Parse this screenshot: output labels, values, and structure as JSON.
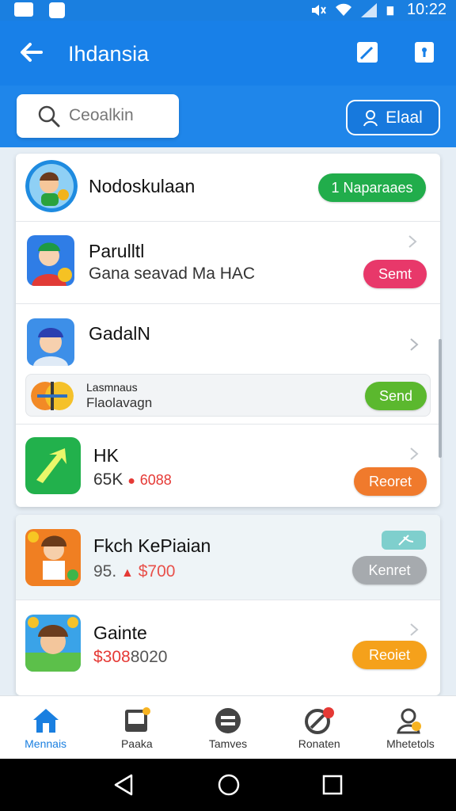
{
  "status_bar": {
    "time": "10:22"
  },
  "header": {
    "title": "Ihdansia"
  },
  "search": {
    "placeholder": "Ceoalkin"
  },
  "filter": {
    "label": "Elaal"
  },
  "list": [
    {
      "title": "Nodoskulaan",
      "action": "1 Naparaaes",
      "action_color": "#21ad4b"
    },
    {
      "title": "Parulltl",
      "subtitle": "Gana seavad Ma HAC",
      "action": "Semt",
      "action_color": "#e8386a"
    },
    {
      "title": "GadalN",
      "subtitle": ""
    },
    {
      "title": "Lasmnaus",
      "subtitle": "Flaolavagn",
      "action": "Send",
      "action_color": "#5bb82e"
    },
    {
      "title": "HK",
      "subtitle_prefix": "65K",
      "subtitle_price": "6088",
      "action": "Reoret",
      "action_color": "#f07a2c"
    },
    {
      "title": "Fkch KePiaian",
      "subtitle_prefix": "95.",
      "subtitle_price": "$700",
      "action": "Kenret",
      "action_color": "#a6aaae"
    },
    {
      "title": "Gainte",
      "subtitle_prefix": "$308",
      "subtitle_price": "8020",
      "action": "Reoiet",
      "action_color": "#f5a11b"
    }
  ],
  "bottom_nav": [
    {
      "label": "Mennais"
    },
    {
      "label": "Paaka"
    },
    {
      "label": "Tamves"
    },
    {
      "label": "Ronaten"
    },
    {
      "label": "Mhetetols"
    }
  ]
}
